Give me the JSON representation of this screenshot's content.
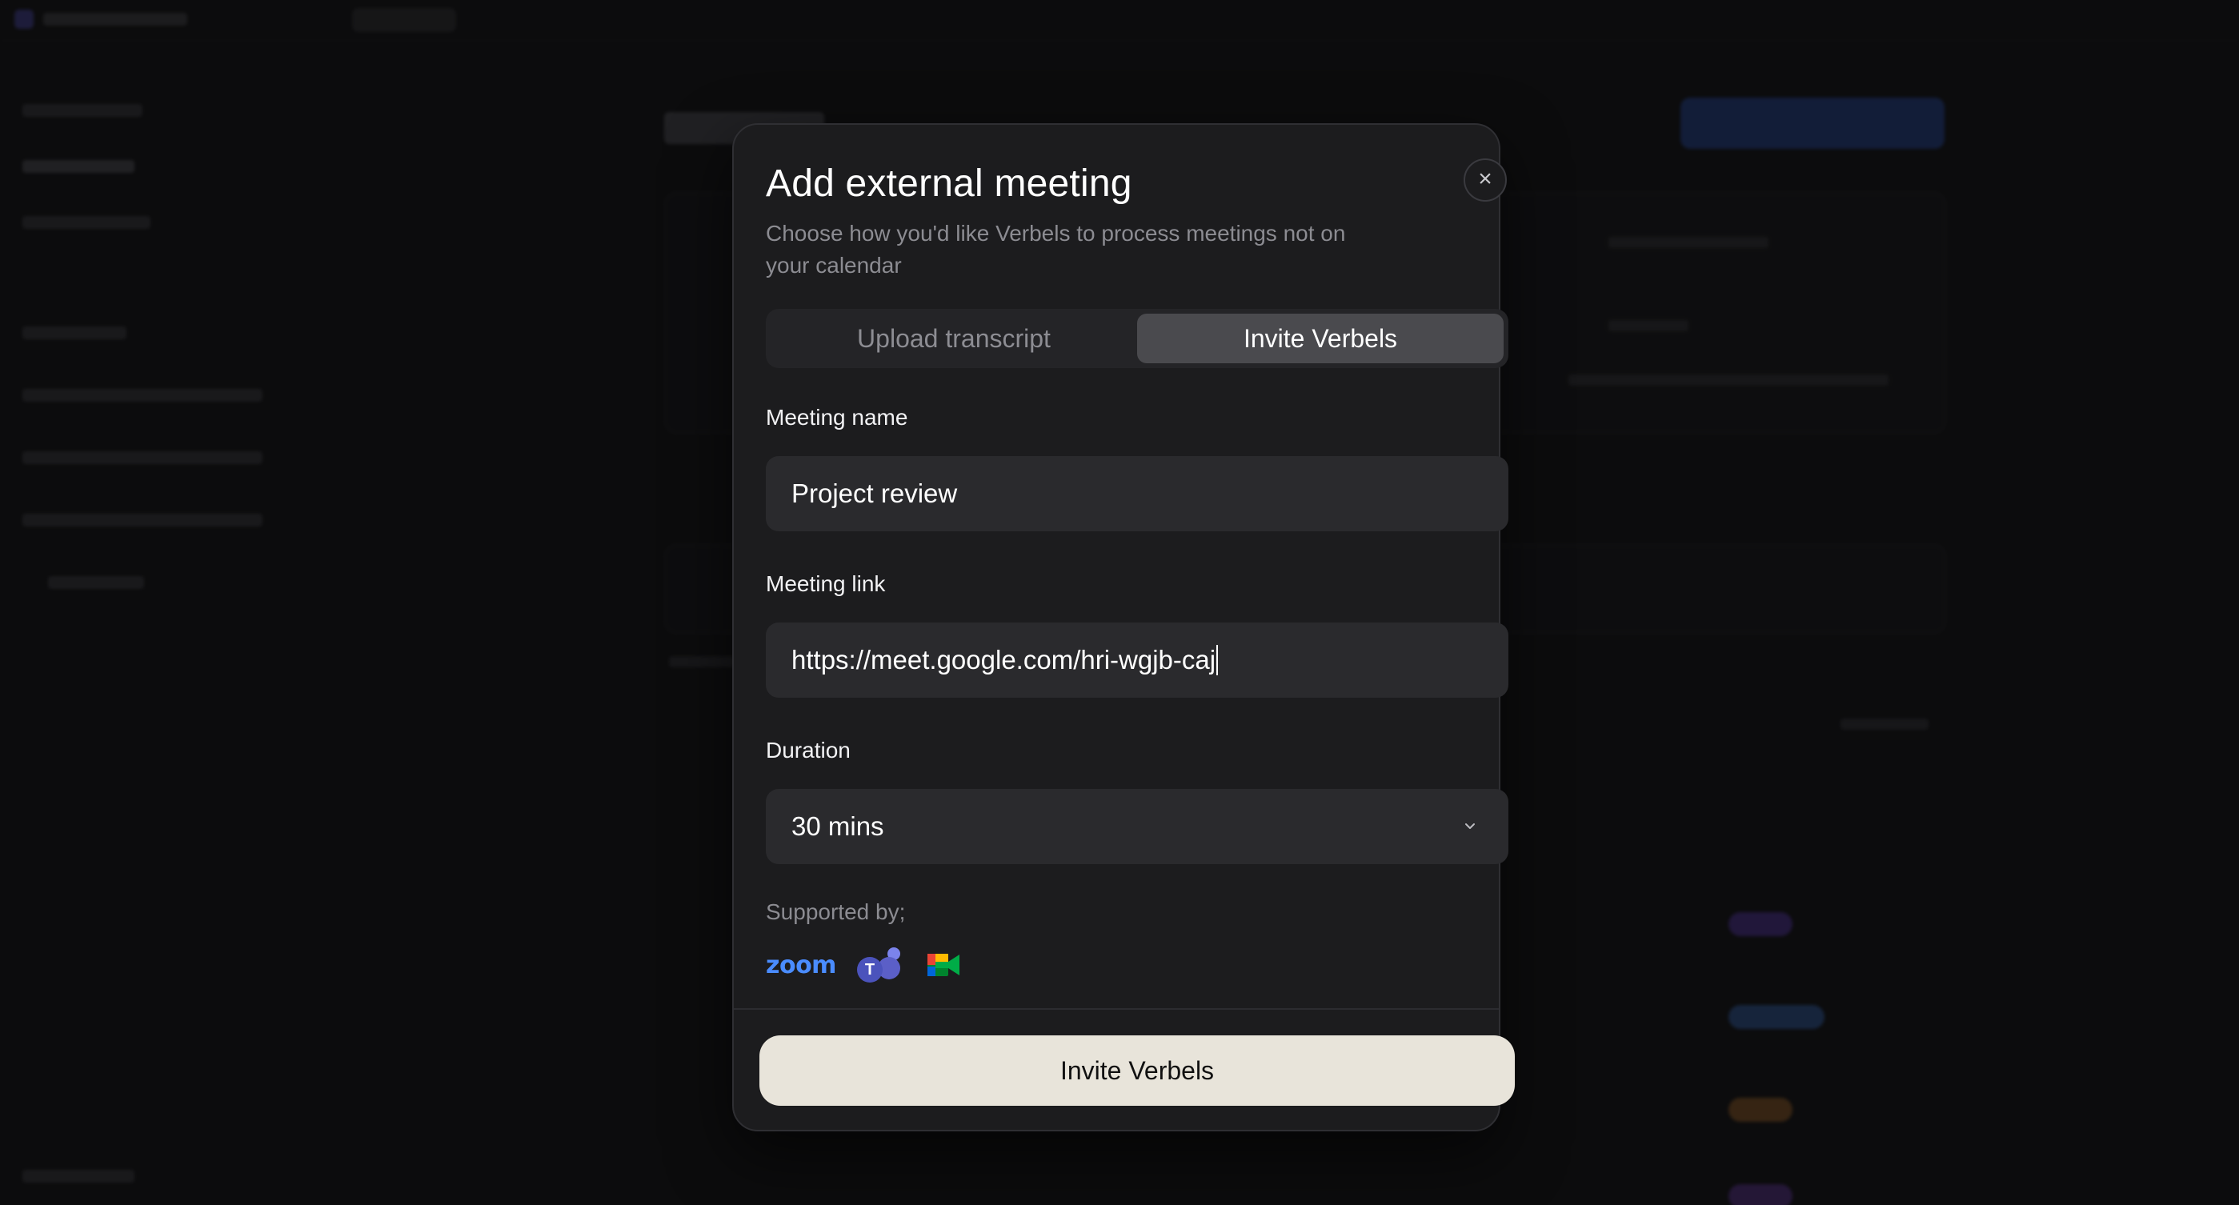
{
  "modal": {
    "title": "Add external meeting",
    "subtitle": "Choose how you'd like Verbels to process meetings not on your calendar",
    "close_icon": "×",
    "tabs": [
      {
        "label": "Upload transcript",
        "active": false
      },
      {
        "label": "Invite Verbels",
        "active": true
      }
    ],
    "fields": {
      "meeting_name": {
        "label": "Meeting name",
        "value": "Project review"
      },
      "meeting_link": {
        "label": "Meeting link",
        "value": "https://meet.google.com/hri-wgjb-caj"
      },
      "duration": {
        "label": "Duration",
        "value": "30 mins"
      }
    },
    "supported": {
      "label": "Supported by;",
      "logos": [
        {
          "name": "zoom-logo",
          "text": "zoom"
        },
        {
          "name": "microsoft-teams-logo",
          "text": "T"
        },
        {
          "name": "google-meet-logo"
        }
      ]
    },
    "submit_label": "Invite Verbels"
  },
  "colors": {
    "modal_bg": "#1c1c1e",
    "field_bg": "#2a2a2d",
    "active_tab_bg": "#4a4a4e",
    "primary_button_bg": "#e8e4da",
    "zoom_blue": "#4a8cff",
    "teams_purple": "#5b5fc7"
  }
}
